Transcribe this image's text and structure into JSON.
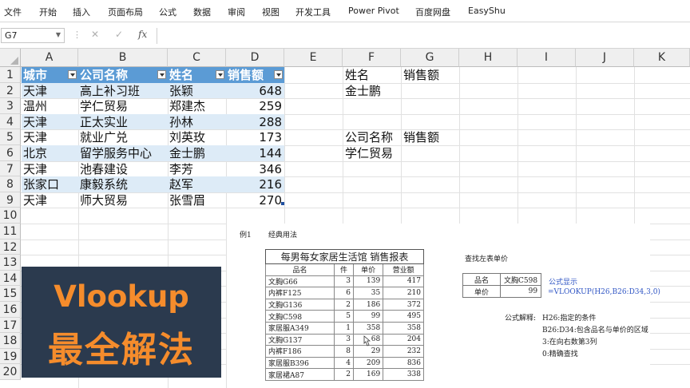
{
  "ribbon": {
    "tabs": [
      "文件",
      "开始",
      "插入",
      "页面布局",
      "公式",
      "数据",
      "审阅",
      "视图",
      "开发工具",
      "Power Pivot",
      "百度网盘",
      "EasyShu"
    ]
  },
  "formula_bar": {
    "name_box": "G7",
    "cancel_glyph": "✕",
    "confirm_glyph": "✓",
    "fx_label": "fx",
    "formula": ""
  },
  "columns": [
    "A",
    "B",
    "C",
    "D",
    "E",
    "F",
    "G",
    "H",
    "I",
    "J",
    "K"
  ],
  "rows": [
    "1",
    "2",
    "3",
    "4",
    "5",
    "6",
    "7",
    "8",
    "9",
    "10",
    "11",
    "12",
    "13",
    "14",
    "15",
    "16",
    "17",
    "18",
    "19",
    "20"
  ],
  "table": {
    "headers": [
      "城市",
      "公司名称",
      "姓名",
      "销售额"
    ],
    "rows": [
      [
        "天津",
        "高上补习班",
        "张颖",
        "648"
      ],
      [
        "温州",
        "学仁贸易",
        "郑建杰",
        "259"
      ],
      [
        "天津",
        "正太实业",
        "孙林",
        "288"
      ],
      [
        "天津",
        "就业广兑",
        "刘英玫",
        "173"
      ],
      [
        "北京",
        "留学服务中心",
        "金士鹏",
        "144"
      ],
      [
        "天津",
        "池春建设",
        "李芳",
        "346"
      ],
      [
        "张家口",
        "康毅系统",
        "赵军",
        "216"
      ],
      [
        "天津",
        "师大贸易",
        "张雪眉",
        "270"
      ]
    ]
  },
  "lookup_cells": {
    "f1": "姓名",
    "g1": "销售额",
    "f2": "金士鹏",
    "f5": "公司名称",
    "g5": "销售额",
    "f6": "学仁贸易"
  },
  "picture": {
    "example_label": "例1",
    "example_name": "经典用法",
    "report_title": "每男每女家居生活馆  销售报表",
    "report_headers": [
      "品名",
      "件",
      "单价",
      "营业额"
    ],
    "report_rows": [
      [
        "文胸G66",
        "3",
        "139",
        "417"
      ],
      [
        "内裤F125",
        "6",
        "35",
        "210"
      ],
      [
        "文胸G136",
        "2",
        "186",
        "372"
      ],
      [
        "文胸C598",
        "5",
        "99",
        "495"
      ],
      [
        "家居服A349",
        "1",
        "358",
        "358"
      ],
      [
        "文胸G137",
        "3",
        "68",
        "204"
      ],
      [
        "内裤F186",
        "8",
        "29",
        "232"
      ],
      [
        "家居服B396",
        "4",
        "209",
        "836"
      ],
      [
        "家居裙A87",
        "2",
        "169",
        "338"
      ]
    ],
    "lookup_title": "查找左表单价",
    "lookup_name_label": "品名",
    "lookup_name_value": "文胸C598",
    "lookup_price_label": "单价",
    "lookup_price_value": "99",
    "formula_show": "公式显示",
    "formula_text": "=VLOOKUP(H26,B26:D34,3,0)",
    "explain_label": "公式解释:",
    "explain_lines": [
      "H26:指定的条件",
      "B26:D34:包含品名与单价的区域",
      "3:在向右数第3列",
      "0:精确查找"
    ]
  },
  "thumbnail": {
    "line1": "Vlookup",
    "line2": "最全解法",
    "text_color": "#f58c2c",
    "bg_color": "#2b3a4e"
  },
  "colors": {
    "table_header": "#5b9bd5",
    "table_band": "#ddebf7",
    "formula_blue": "#2f55c4"
  }
}
